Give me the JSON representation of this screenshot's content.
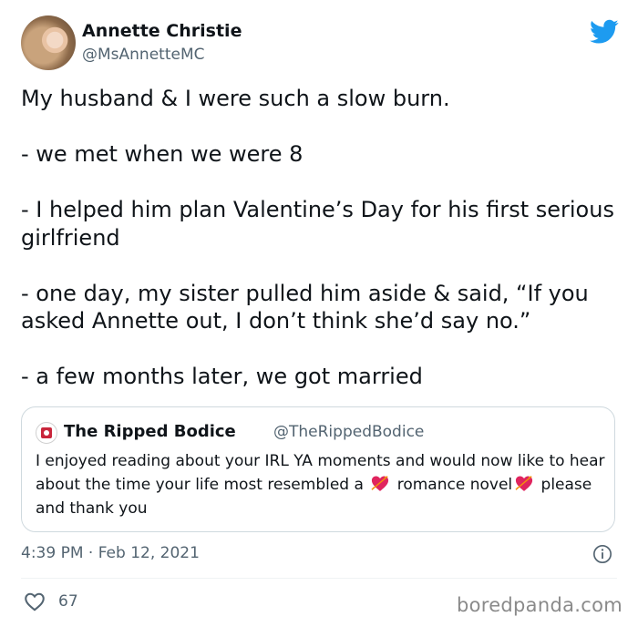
{
  "author": {
    "name": "Annette Christie",
    "handle": "@MsAnnetteMC"
  },
  "tweet": {
    "text": "My husband & I were such a slow burn.\n\n- we met when we were 8\n\n- I helped him plan Valentine’s Day for his first serious girlfriend\n\n- one day, my sister pulled him aside & said, “If you asked Annette out, I don’t think she’d say no.”\n\n- a few months later, we got married"
  },
  "quoted": {
    "name": "The Ripped Bodice",
    "handle": "@TheRippedBodice",
    "text_part1": "I enjoyed reading about your IRL YA  moments and would now like to hear about the time your life most resembled a ",
    "text_part2": " romance novel",
    "text_part3": " please and thank you"
  },
  "meta": {
    "timestamp": "4:39 PM · Feb 12, 2021",
    "likes": "67"
  },
  "watermark": "boredpanda.com",
  "colors": {
    "twitter_blue": "#1d9bf0",
    "secondary_text": "#536471",
    "border": "#cfd9de"
  },
  "icons": {
    "bird": "twitter-bird-icon",
    "heart_emoji": "heart-with-arrow-emoji",
    "info": "info-icon",
    "like": "heart-outline-icon"
  }
}
